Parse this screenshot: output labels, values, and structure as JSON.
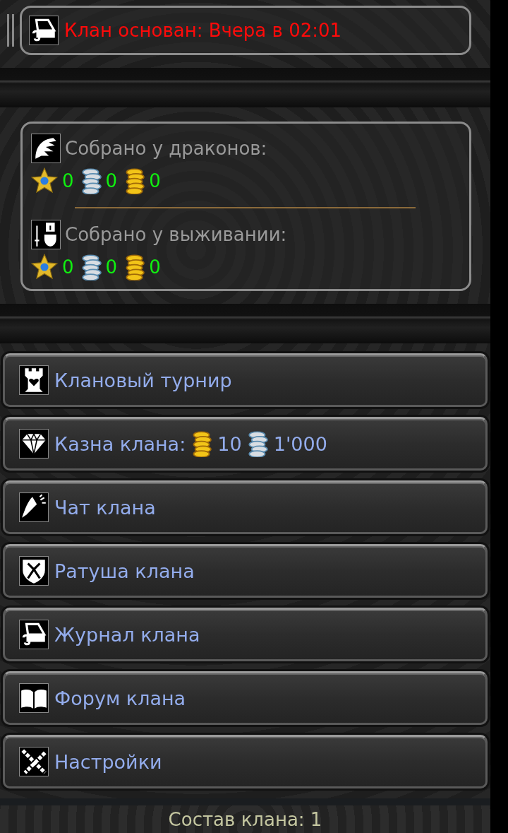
{
  "founded": {
    "text": "Клан основан: Вчера в 02:01"
  },
  "collected": [
    {
      "title": "Собрано у драконов:",
      "amounts": [
        {
          "kind": "star",
          "value": "0"
        },
        {
          "kind": "silver",
          "value": "0"
        },
        {
          "kind": "gold",
          "value": "0"
        }
      ]
    },
    {
      "title": "Собрано у выживании:",
      "amounts": [
        {
          "kind": "star",
          "value": "0"
        },
        {
          "kind": "silver",
          "value": "0"
        },
        {
          "kind": "gold",
          "value": "0"
        }
      ]
    }
  ],
  "menu": [
    {
      "label": "Клановый турнир"
    },
    {
      "label": "Казна клана:",
      "amounts": [
        {
          "kind": "gold",
          "value": "10"
        },
        {
          "kind": "silver",
          "value": "1'000"
        }
      ]
    },
    {
      "label": "Чат клана"
    },
    {
      "label": "Ратуша клана"
    },
    {
      "label": "Журнал клана"
    },
    {
      "label": "Форум клана"
    },
    {
      "label": "Настройки"
    }
  ],
  "footer": "Состав клана: 1"
}
